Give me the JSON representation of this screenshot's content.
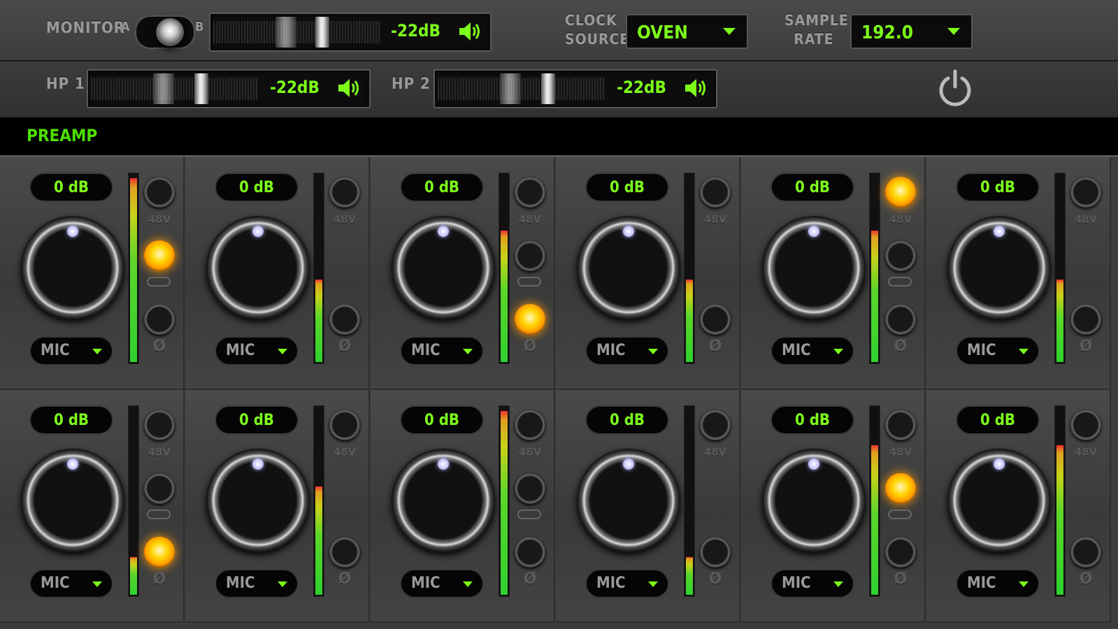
{
  "monitor": {
    "label": "MONITOR",
    "left": "A",
    "right": "B",
    "level": "-22dB"
  },
  "hp1": {
    "label": "HP 1",
    "level": "-22dB"
  },
  "hp2": {
    "label": "HP 2",
    "level": "-22dB"
  },
  "clock": {
    "label_line1": "CLOCK",
    "label_line2": "SOURCE",
    "value": "OVEN"
  },
  "sample_rate": {
    "label_line1": "SAMPLE",
    "label_line2": "RATE",
    "value": "192.0"
  },
  "preamp": {
    "title": "PREAMP"
  },
  "labels": {
    "phantom": "48V",
    "link": "",
    "phase": "Ø"
  },
  "colors": {
    "accent": "#7dff1a",
    "led_on": "#ffb000"
  },
  "channels": [
    {
      "gain": "0 dB",
      "type": "MIC",
      "meter": 0.98,
      "phantom": false,
      "link": true,
      "phase": false,
      "has_link": true
    },
    {
      "gain": "0 dB",
      "type": "MIC",
      "meter": 0.44,
      "phantom": false,
      "link": false,
      "phase": false,
      "has_link": false
    },
    {
      "gain": "0 dB",
      "type": "MIC",
      "meter": 0.7,
      "phantom": false,
      "link": false,
      "phase": true,
      "has_link": true
    },
    {
      "gain": "0 dB",
      "type": "MIC",
      "meter": 0.44,
      "phantom": false,
      "link": false,
      "phase": false,
      "has_link": false
    },
    {
      "gain": "0 dB",
      "type": "MIC",
      "meter": 0.7,
      "phantom": true,
      "link": false,
      "phase": false,
      "has_link": true
    },
    {
      "gain": "0 dB",
      "type": "MIC",
      "meter": 0.44,
      "phantom": false,
      "link": false,
      "phase": false,
      "has_link": false
    },
    {
      "gain": "0 dB",
      "type": "MIC",
      "meter": 0.2,
      "phantom": false,
      "link": false,
      "phase": true,
      "has_link": true
    },
    {
      "gain": "0 dB",
      "type": "MIC",
      "meter": 0.58,
      "phantom": false,
      "link": false,
      "phase": false,
      "has_link": false
    },
    {
      "gain": "0 dB",
      "type": "MIC",
      "meter": 0.98,
      "phantom": false,
      "link": false,
      "phase": false,
      "has_link": true
    },
    {
      "gain": "0 dB",
      "type": "MIC",
      "meter": 0.2,
      "phantom": false,
      "link": false,
      "phase": false,
      "has_link": false
    },
    {
      "gain": "0 dB",
      "type": "MIC",
      "meter": 0.8,
      "phantom": false,
      "link": true,
      "phase": false,
      "has_link": true
    },
    {
      "gain": "0 dB",
      "type": "MIC",
      "meter": 0.8,
      "phantom": false,
      "link": false,
      "phase": false,
      "has_link": false
    }
  ]
}
